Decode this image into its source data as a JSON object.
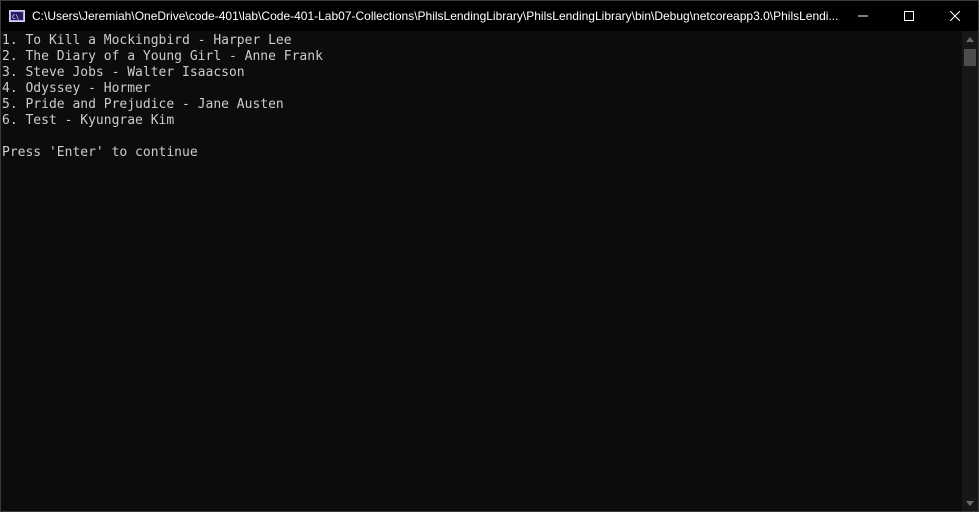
{
  "window": {
    "title": "C:\\Users\\Jeremiah\\OneDrive\\code-401\\lab\\Code-401-Lab07-Collections\\PhilsLendingLibrary\\PhilsLendingLibrary\\bin\\Debug\\netcoreapp3.0\\PhilsLendi..."
  },
  "console": {
    "lines": [
      "1. To Kill a Mockingbird - Harper Lee",
      "2. The Diary of a Young Girl - Anne Frank",
      "3. Steve Jobs - Walter Isaacson",
      "4. Odyssey - Hormer",
      "5. Pride and Prejudice - Jane Austen",
      "6. Test - Kyungrae Kim",
      "",
      "Press 'Enter' to continue"
    ]
  },
  "icons": {
    "app": "console-app-icon",
    "minimize": "minimize-icon",
    "maximize": "maximize-icon",
    "close": "close-icon",
    "scroll_up": "chevron-up-icon",
    "scroll_down": "chevron-down-icon"
  },
  "colors": {
    "background": "#0c0c0c",
    "text": "#cccccc",
    "titlebar": "#000000",
    "scrollbar_track": "#171717",
    "scrollbar_thumb": "#4d4d4d"
  }
}
